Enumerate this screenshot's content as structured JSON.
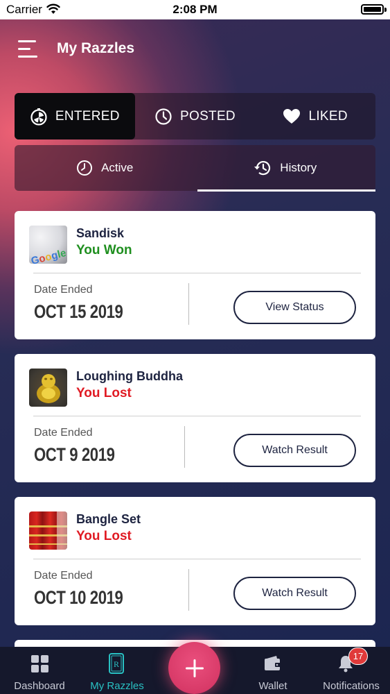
{
  "statusbar": {
    "carrier": "Carrier",
    "time": "2:08 PM"
  },
  "header": {
    "title": "My Razzles",
    "menu_icon": "hamburger-icon"
  },
  "tabs": [
    {
      "label": "ENTERED",
      "icon": "stopwatch-icon",
      "active": true
    },
    {
      "label": "POSTED",
      "icon": "clock-icon",
      "active": false
    },
    {
      "label": "LIKED",
      "icon": "heart-icon",
      "active": false
    }
  ],
  "subtabs": [
    {
      "label": "Active",
      "icon": "clock-icon",
      "active": false
    },
    {
      "label": "History",
      "icon": "history-icon",
      "active": true
    }
  ],
  "cards": [
    {
      "name": "Sandisk",
      "status": "You Won",
      "status_color": "#1f8f1f",
      "date_label": "Date Ended",
      "date": "OCT 15 2019",
      "action": "View Status"
    },
    {
      "name": "Loughing Buddha",
      "status": "You Lost",
      "status_color": "#e01b24",
      "date_label": "Date Ended",
      "date": "OCT 9 2019",
      "action": "Watch Result"
    },
    {
      "name": "Bangle Set",
      "status": "You Lost",
      "status_color": "#e01b24",
      "date_label": "Date Ended",
      "date": "OCT 10 2019",
      "action": "Watch Result"
    }
  ],
  "tabbar": {
    "items": [
      {
        "label": "Dashboard",
        "icon": "grid-icon",
        "active": false
      },
      {
        "label": "My Razzles",
        "icon": "razzle-card-icon",
        "active": true
      },
      {
        "label": "Wallet",
        "icon": "wallet-icon",
        "active": false
      },
      {
        "label": "Notifications",
        "icon": "bell-icon",
        "active": false,
        "badge": "17"
      }
    ],
    "fab_icon": "plus-icon"
  },
  "colors": {
    "accent": "#29c1c3",
    "won": "#1f8f1f",
    "lost": "#e01b24",
    "fab": "#d83a68"
  }
}
